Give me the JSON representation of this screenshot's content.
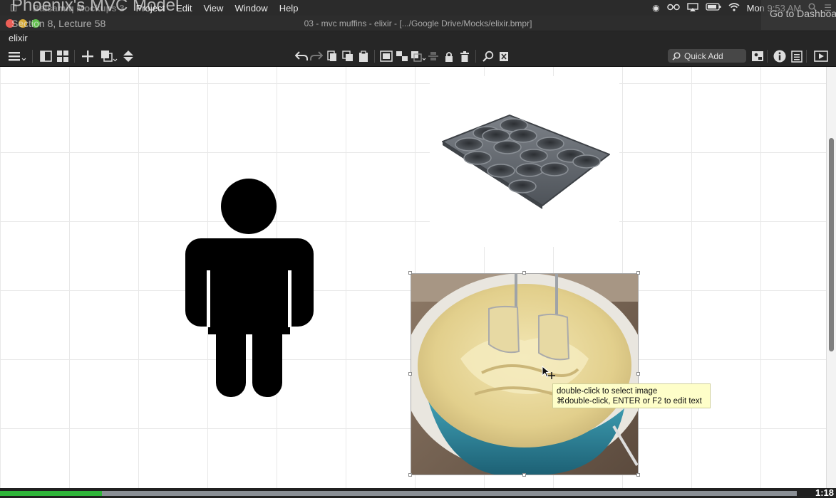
{
  "video": {
    "title": "Phoenix's MVC Model",
    "subtitle": "Section 8, Lecture 58",
    "dashboard_link": "Go to Dashboard",
    "time": "1:18",
    "progress": 0.128
  },
  "menubar": {
    "apple_icon": "apple-icon",
    "app_name": "Balsamiq Mockups 3",
    "items": [
      "Project",
      "Edit",
      "View",
      "Window",
      "Help"
    ],
    "clock": "Mon 9:53 AM",
    "status_icons": [
      "record-icon",
      "glasses-icon",
      "airplay-icon",
      "battery-icon",
      "wifi-icon",
      "search-icon",
      "list-icon"
    ]
  },
  "window": {
    "title": "03 - mvc muffins - elixir - [.../Google Drive/Mocks/elixir.bmpr]",
    "doc_name": "elixir",
    "traffic_colors": {
      "close": "#ec5f57",
      "minimize": "#d7aa36",
      "zoom": "#5fc14a"
    }
  },
  "toolbar": {
    "quick_add_placeholder": "Quick Add"
  },
  "canvas": {
    "tooltip": {
      "line1": "double-click to select image",
      "line2": "⌘double-click, ENTER or F2 to edit text"
    },
    "images": [
      "muffin-tray-image",
      "mixing-bowl-image",
      "person-icon"
    ]
  }
}
